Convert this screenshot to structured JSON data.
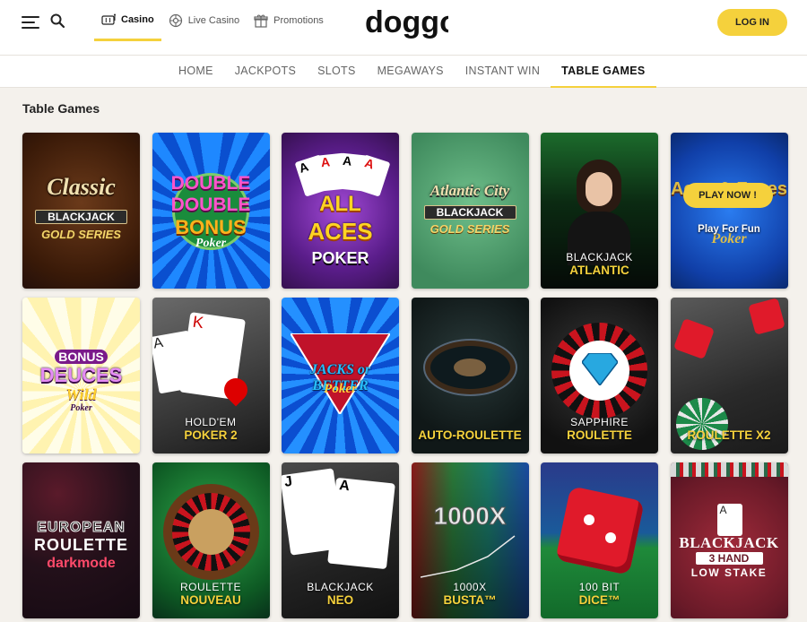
{
  "header": {
    "nav": [
      {
        "label": "Casino",
        "icon": "slot-machine-icon",
        "active": true
      },
      {
        "label": "Live Casino",
        "icon": "live-casino-icon",
        "active": false
      },
      {
        "label": "Promotions",
        "icon": "gift-icon",
        "active": false
      }
    ],
    "logo_text": "doggo",
    "login_label": "LOG IN",
    "accent_color": "#f5d13c"
  },
  "subnav": {
    "items": [
      "HOME",
      "JACKPOTS",
      "SLOTS",
      "MEGAWAYS",
      "INSTANT WIN",
      "TABLE GAMES"
    ],
    "active": "TABLE GAMES"
  },
  "section_title": "Table Games",
  "games": [
    {
      "line1": "Classic",
      "line2": "BLACKJACK",
      "line3": "GOLD SERIES"
    },
    {
      "line1": "DOUBLE",
      "line2": "DOUBLE",
      "line3": "BONUS",
      "line4": "Poker"
    },
    {
      "line1": "ALL",
      "line2": "ACES",
      "line3": "POKER"
    },
    {
      "line1": "Atlantic City",
      "line2": "BLACKJACK",
      "line3": "GOLD SERIES"
    },
    {
      "line1": "BLACKJACK",
      "line2": "ATLANTIC"
    },
    {
      "play_label": "PLAY NOW !",
      "fun_label": "Play For Fun",
      "line1": "Aces & Faces",
      "line2": "Poker"
    },
    {
      "line1": "BONUS",
      "line2": "DEUCES",
      "line3": "Wild",
      "line4": "Poker"
    },
    {
      "line1": "HOLD'EM",
      "line2": "POKER 2"
    },
    {
      "line1": "JACKS or BETTER",
      "line2": "Poker"
    },
    {
      "line1": "",
      "line2": "AUTO-ROULETTE"
    },
    {
      "line1": "SAPPHIRE",
      "line2": "ROULETTE"
    },
    {
      "line1": "",
      "line2": "ROULETTE X2"
    },
    {
      "line1": "EUROPEAN",
      "line2": "ROULETTE",
      "line3": "darkmode"
    },
    {
      "line1": "ROULETTE",
      "line2": "NOUVEAU"
    },
    {
      "line1": "BLACKJACK",
      "line2": "NEO"
    },
    {
      "line1": "1000X",
      "line2": "BUSTA™",
      "art": "1000X"
    },
    {
      "line1": "100 BIT",
      "line2": "DICE™"
    },
    {
      "line1": "BLACKJACK",
      "line2": "3 HAND",
      "line3": "LOW STAKE"
    }
  ]
}
